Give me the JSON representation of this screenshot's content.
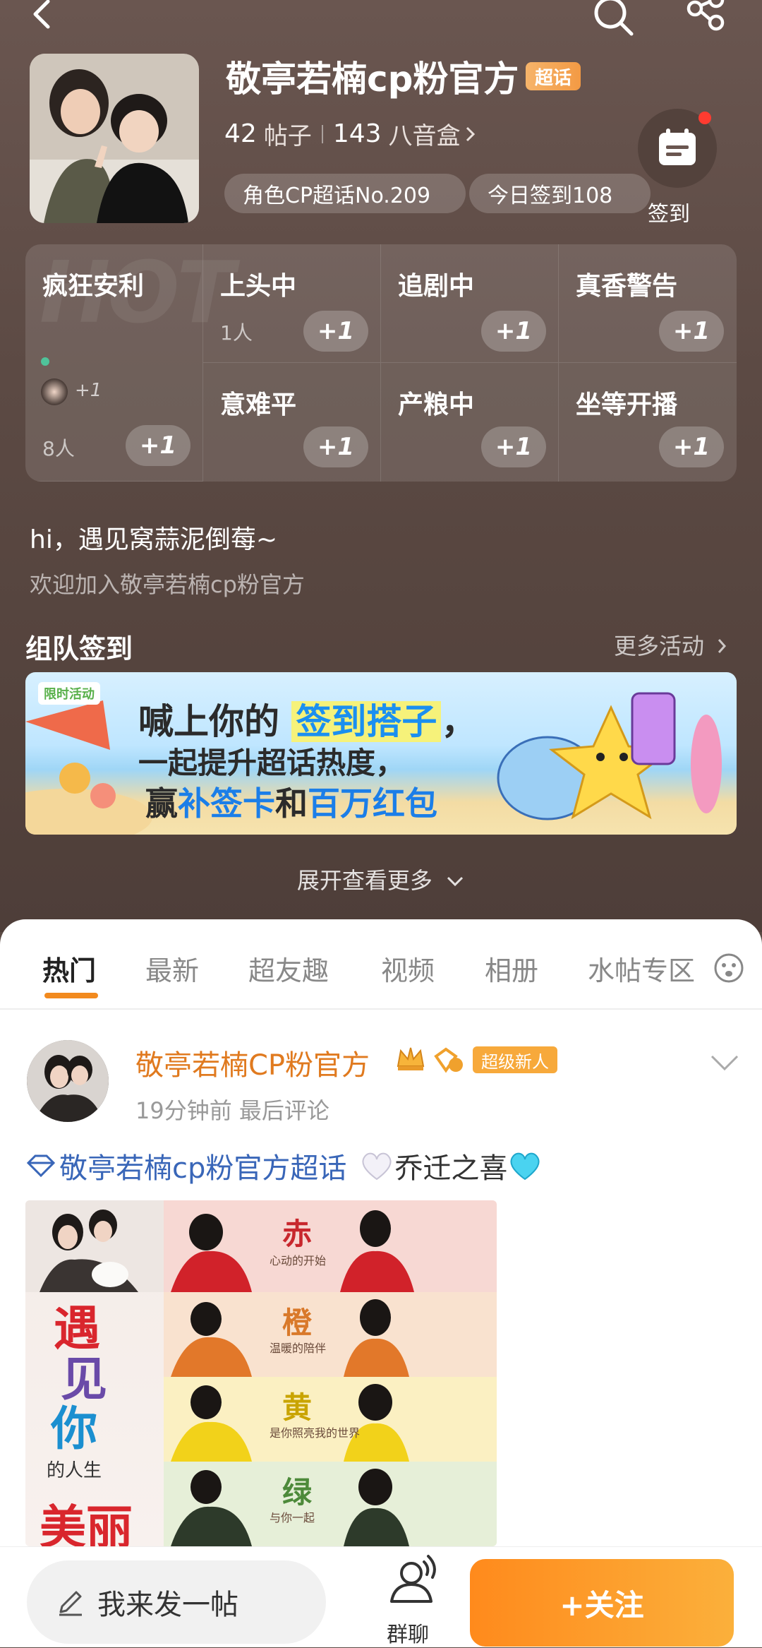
{
  "topbar": {
    "back_icon": "chevron-left-icon",
    "search_icon": "search-icon",
    "share_icon": "share-icon"
  },
  "header": {
    "title": "敬亭若楠cp粉官方",
    "badge": "超话",
    "posts_count": "42",
    "posts_label": "帖子",
    "music_count": "143",
    "music_label": "八音盒",
    "rank_chip": "角色CP超话No.209",
    "checkin_chip": "今日签到108",
    "signin_label": "签到"
  },
  "moods": {
    "watermark": "HOT",
    "featured": {
      "title": "疯狂安利",
      "avatar_plus": "+1",
      "count": "8人",
      "plus": "+1"
    },
    "items": [
      {
        "title": "上头中",
        "count": "1人",
        "plus": "+1"
      },
      {
        "title": "追剧中",
        "plus": "+1"
      },
      {
        "title": "真香警告",
        "plus": "+1"
      },
      {
        "title": "意难平",
        "plus": "+1"
      },
      {
        "title": "产粮中",
        "plus": "+1"
      },
      {
        "title": "坐等开播",
        "plus": "+1"
      }
    ]
  },
  "welcome": {
    "line1": "hi，遇见窝蒜泥倒莓~",
    "line2": "欢迎加入敬亭若楠cp粉官方"
  },
  "team_checkin": {
    "title": "组队签到",
    "more": "更多活动",
    "banner": {
      "tag": "限时活动",
      "line1_a": "喊上你的",
      "line1_b": "签到搭子",
      "line1_c": "，",
      "line2": "一起提升超话热度，",
      "line3_a": "赢",
      "line3_b": "补签卡",
      "line3_c": "和",
      "line3_d": "百万红包"
    }
  },
  "expand_more": "展开查看更多",
  "tabs": [
    "热门",
    "最新",
    "超友趣",
    "视频",
    "相册",
    "水帖专区"
  ],
  "post": {
    "author": "敬亭若楠CP粉官方",
    "badge": "超级新人",
    "meta": "19分钟前 最后评论",
    "topic": "敬亭若楠cp粉官方超话",
    "text": "乔迁之喜",
    "image": {
      "left_chars": [
        "遇",
        "见",
        "你",
        "的人生",
        "美丽"
      ],
      "strips": [
        {
          "word": "赤",
          "sub": "心动的开始",
          "color": "#c8272d",
          "bg": "#f7d8d3"
        },
        {
          "word": "橙",
          "sub": "温暖的陪伴",
          "color": "#d9792a",
          "bg": "#f9e2cf"
        },
        {
          "word": "黄",
          "sub": "是你照亮我的世界",
          "color": "#c9a400",
          "bg": "#fbf0c2"
        },
        {
          "word": "绿",
          "sub": "与你一起",
          "color": "#4d8a3a",
          "bg": "#e6efd8"
        }
      ]
    }
  },
  "bottom": {
    "compose": "我来发一帖",
    "groupchat": "群聊",
    "follow": "+关注"
  }
}
